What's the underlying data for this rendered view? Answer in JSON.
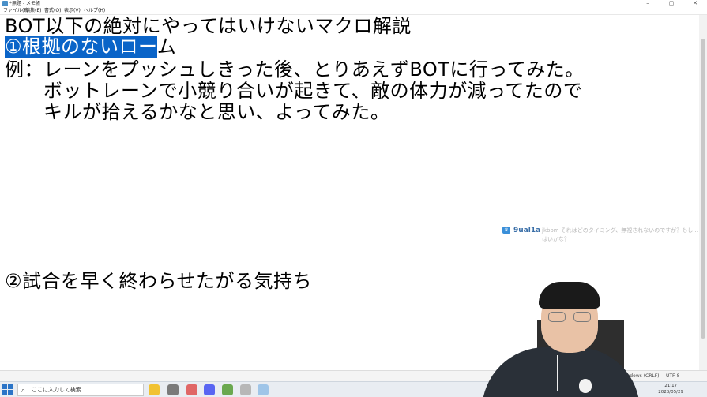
{
  "window": {
    "title": "*無題 - メモ帳",
    "controls": [
      "–",
      "▢",
      "✕"
    ]
  },
  "menu": [
    "ファイル(F)",
    "編集(E)",
    "書式(O)",
    "表示(V)",
    "ヘルプ(H)"
  ],
  "document": {
    "line1": "BOT以下の絶対にやってはいけないマクロ解説",
    "line2_selected": "①根拠のないロー",
    "line2_rest": "ム",
    "line3": "例：レーンをプッシュしきった後、とりあえずBOTに行ってみた。",
    "line4": "　　ボットレーンで小競り合いが起きて、敵の体力が減ってたので",
    "line5": "　　キルが拾えるかなと思い、よってみた。",
    "line6": "②試合を早く終わらせたがる気持ち"
  },
  "chat": {
    "username": "9ual1a",
    "message": "jkbom それはどのタイミング、無視されないのですが？もし... はいかな？"
  },
  "statusbar": {
    "line_ending": "Windows (CRLF)",
    "encoding": "UTF-8"
  },
  "taskbar": {
    "search_placeholder": "ここに入力して検索",
    "time": "21:17",
    "date": "2023/05/29"
  },
  "colors": {
    "selection": "#0a64c8",
    "chat_user": "#3a6fa8",
    "taskbar": "#e9edf2"
  }
}
